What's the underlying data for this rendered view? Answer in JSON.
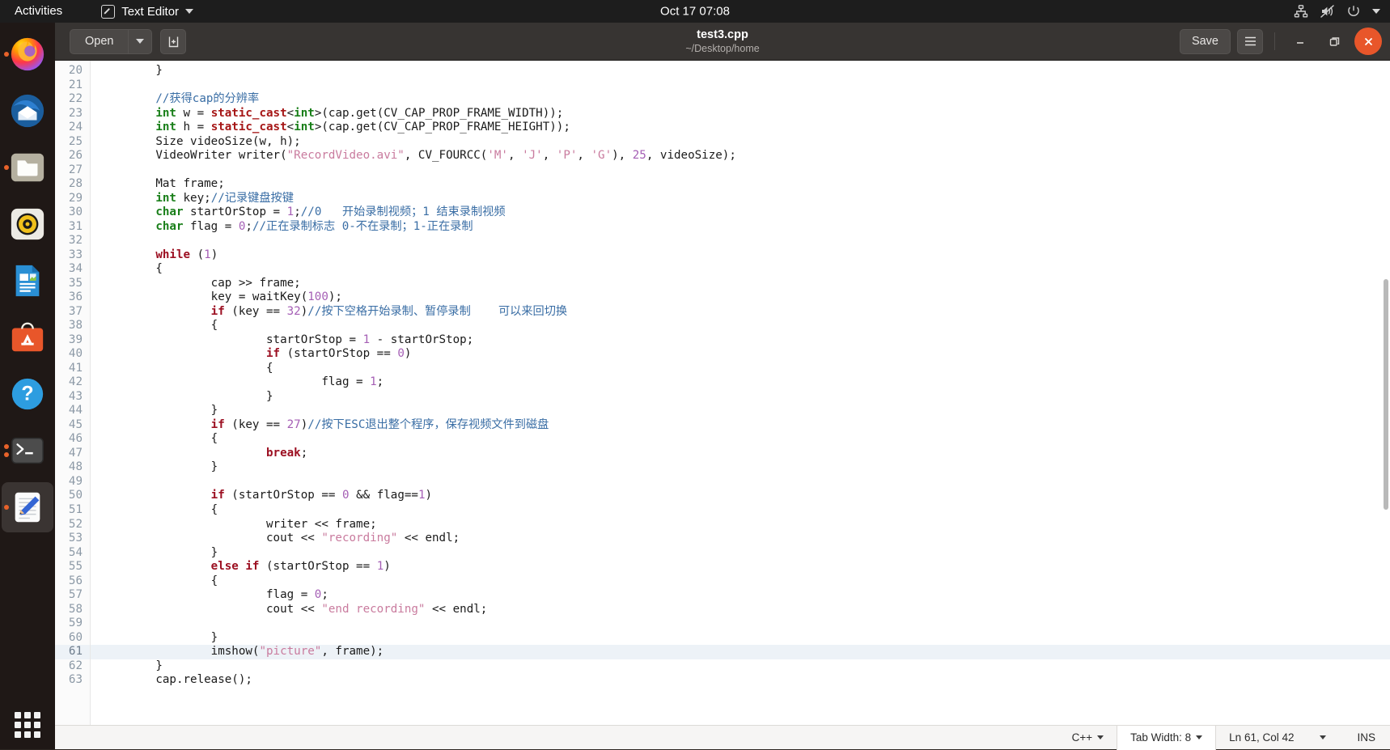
{
  "topbar": {
    "activities": "Activities",
    "app_name": "Text Editor",
    "clock": "Oct 17 07:08",
    "tray_icons": [
      "network-icon",
      "volume-muted-icon",
      "power-icon",
      "chevron-down-icon"
    ]
  },
  "dock": {
    "items": [
      {
        "name": "firefox",
        "label": "Firefox",
        "dots": 1,
        "active": false
      },
      {
        "name": "thunderbird",
        "label": "Thunderbird",
        "dots": 0,
        "active": false
      },
      {
        "name": "files",
        "label": "Files",
        "dots": 1,
        "active": false
      },
      {
        "name": "rhythmbox",
        "label": "Rhythmbox",
        "dots": 0,
        "active": false
      },
      {
        "name": "libreoffice-writer",
        "label": "LibreOffice Writer",
        "dots": 0,
        "active": false
      },
      {
        "name": "ubuntu-software",
        "label": "Ubuntu Software",
        "dots": 0,
        "active": false
      },
      {
        "name": "help",
        "label": "Help",
        "dots": 0,
        "active": false
      },
      {
        "name": "terminal",
        "label": "Terminal",
        "dots": 2,
        "active": false
      },
      {
        "name": "text-editor",
        "label": "Text Editor",
        "dots": 1,
        "active": true
      }
    ],
    "show_apps_label": "Show Applications"
  },
  "headerbar": {
    "open_label": "Open",
    "open_dropdown_icon": "chevron-down-icon",
    "new_document_icon": "new-document-icon",
    "title": "test3.cpp",
    "subtitle": "~/Desktop/home",
    "save_label": "Save",
    "menu_icon": "hamburger-menu-icon",
    "minimize_icon": "minimize-icon",
    "maximize_icon": "maximize-icon",
    "close_icon": "close-icon",
    "close_color": "#e8562a"
  },
  "statusbar": {
    "language": "C++",
    "tab_width": "Tab Width: 8",
    "position": "Ln 61, Col 42",
    "insert_mode": "INS",
    "caret_icon": "chevron-down-icon"
  },
  "editor": {
    "first_line": 20,
    "current_line": 61,
    "lines": [
      {
        "n": 20,
        "tokens": [
          {
            "c": "",
            "s": "        }"
          }
        ]
      },
      {
        "n": 21,
        "tokens": [
          {
            "c": "",
            "s": ""
          }
        ]
      },
      {
        "n": 22,
        "tokens": [
          {
            "c": "cm",
            "s": "        //获得cap的分辨率"
          }
        ]
      },
      {
        "n": 23,
        "tokens": [
          {
            "c": "",
            "s": "        "
          },
          {
            "c": "t",
            "s": "int"
          },
          {
            "c": "",
            "s": " w = "
          },
          {
            "c": "cst",
            "s": "static_cast"
          },
          {
            "c": "",
            "s": "<"
          },
          {
            "c": "t",
            "s": "int"
          },
          {
            "c": "",
            "s": ">(cap.get(CV_CAP_PROP_FRAME_WIDTH));"
          }
        ]
      },
      {
        "n": 24,
        "tokens": [
          {
            "c": "",
            "s": "        "
          },
          {
            "c": "t",
            "s": "int"
          },
          {
            "c": "",
            "s": " h = "
          },
          {
            "c": "cst",
            "s": "static_cast"
          },
          {
            "c": "",
            "s": "<"
          },
          {
            "c": "t",
            "s": "int"
          },
          {
            "c": "",
            "s": ">(cap.get(CV_CAP_PROP_FRAME_HEIGHT));"
          }
        ]
      },
      {
        "n": 25,
        "tokens": [
          {
            "c": "",
            "s": "        Size videoSize(w, h);"
          }
        ]
      },
      {
        "n": 26,
        "tokens": [
          {
            "c": "",
            "s": "        VideoWriter writer("
          },
          {
            "c": "st",
            "s": "\"RecordVideo.avi\""
          },
          {
            "c": "",
            "s": ", CV_FOURCC("
          },
          {
            "c": "st",
            "s": "'M'"
          },
          {
            "c": "",
            "s": ", "
          },
          {
            "c": "st",
            "s": "'J'"
          },
          {
            "c": "",
            "s": ", "
          },
          {
            "c": "st",
            "s": "'P'"
          },
          {
            "c": "",
            "s": ", "
          },
          {
            "c": "st",
            "s": "'G'"
          },
          {
            "c": "",
            "s": "), "
          },
          {
            "c": "nm",
            "s": "25"
          },
          {
            "c": "",
            "s": ", videoSize);"
          }
        ]
      },
      {
        "n": 27,
        "tokens": [
          {
            "c": "",
            "s": ""
          }
        ]
      },
      {
        "n": 28,
        "tokens": [
          {
            "c": "",
            "s": "        Mat frame;"
          }
        ]
      },
      {
        "n": 29,
        "tokens": [
          {
            "c": "",
            "s": "        "
          },
          {
            "c": "t",
            "s": "int"
          },
          {
            "c": "",
            "s": " key;"
          },
          {
            "c": "cm",
            "s": "//记录键盘按键"
          }
        ]
      },
      {
        "n": 30,
        "tokens": [
          {
            "c": "",
            "s": "        "
          },
          {
            "c": "t",
            "s": "char"
          },
          {
            "c": "",
            "s": " startOrStop = "
          },
          {
            "c": "nm",
            "s": "1"
          },
          {
            "c": "",
            "s": ";"
          },
          {
            "c": "cm",
            "s": "//0   开始录制视频；1 结束录制视频"
          }
        ]
      },
      {
        "n": 31,
        "tokens": [
          {
            "c": "",
            "s": "        "
          },
          {
            "c": "t",
            "s": "char"
          },
          {
            "c": "",
            "s": " flag = "
          },
          {
            "c": "nm",
            "s": "0"
          },
          {
            "c": "",
            "s": ";"
          },
          {
            "c": "cm",
            "s": "//正在录制标志 0-不在录制；1-正在录制"
          }
        ]
      },
      {
        "n": 32,
        "tokens": [
          {
            "c": "",
            "s": ""
          }
        ]
      },
      {
        "n": 33,
        "tokens": [
          {
            "c": "",
            "s": "        "
          },
          {
            "c": "k",
            "s": "while"
          },
          {
            "c": "",
            "s": " ("
          },
          {
            "c": "nm",
            "s": "1"
          },
          {
            "c": "",
            "s": ")"
          }
        ]
      },
      {
        "n": 34,
        "tokens": [
          {
            "c": "",
            "s": "        {"
          }
        ]
      },
      {
        "n": 35,
        "tokens": [
          {
            "c": "",
            "s": "                cap >> frame;"
          }
        ]
      },
      {
        "n": 36,
        "tokens": [
          {
            "c": "",
            "s": "                key = waitKey("
          },
          {
            "c": "nm",
            "s": "100"
          },
          {
            "c": "",
            "s": ");"
          }
        ]
      },
      {
        "n": 37,
        "tokens": [
          {
            "c": "",
            "s": "                "
          },
          {
            "c": "k",
            "s": "if"
          },
          {
            "c": "",
            "s": " (key == "
          },
          {
            "c": "nm",
            "s": "32"
          },
          {
            "c": "",
            "s": ")"
          },
          {
            "c": "cm",
            "s": "//按下空格开始录制、暂停录制    可以来回切换"
          }
        ]
      },
      {
        "n": 38,
        "tokens": [
          {
            "c": "",
            "s": "                {"
          }
        ]
      },
      {
        "n": 39,
        "tokens": [
          {
            "c": "",
            "s": "                        startOrStop = "
          },
          {
            "c": "nm",
            "s": "1"
          },
          {
            "c": "",
            "s": " - startOrStop;"
          }
        ]
      },
      {
        "n": 40,
        "tokens": [
          {
            "c": "",
            "s": "                        "
          },
          {
            "c": "k",
            "s": "if"
          },
          {
            "c": "",
            "s": " (startOrStop == "
          },
          {
            "c": "nm",
            "s": "0"
          },
          {
            "c": "",
            "s": ")"
          }
        ]
      },
      {
        "n": 41,
        "tokens": [
          {
            "c": "",
            "s": "                        {"
          }
        ]
      },
      {
        "n": 42,
        "tokens": [
          {
            "c": "",
            "s": "                                flag = "
          },
          {
            "c": "nm",
            "s": "1"
          },
          {
            "c": "",
            "s": ";"
          }
        ]
      },
      {
        "n": 43,
        "tokens": [
          {
            "c": "",
            "s": "                        }"
          }
        ]
      },
      {
        "n": 44,
        "tokens": [
          {
            "c": "",
            "s": "                }"
          }
        ]
      },
      {
        "n": 45,
        "tokens": [
          {
            "c": "",
            "s": "                "
          },
          {
            "c": "k",
            "s": "if"
          },
          {
            "c": "",
            "s": " (key == "
          },
          {
            "c": "nm",
            "s": "27"
          },
          {
            "c": "",
            "s": ")"
          },
          {
            "c": "cm",
            "s": "//按下ESC退出整个程序，保存视频文件到磁盘"
          }
        ]
      },
      {
        "n": 46,
        "tokens": [
          {
            "c": "",
            "s": "                {"
          }
        ]
      },
      {
        "n": 47,
        "tokens": [
          {
            "c": "",
            "s": "                        "
          },
          {
            "c": "k",
            "s": "break"
          },
          {
            "c": "",
            "s": ";"
          }
        ]
      },
      {
        "n": 48,
        "tokens": [
          {
            "c": "",
            "s": "                }"
          }
        ]
      },
      {
        "n": 49,
        "tokens": [
          {
            "c": "",
            "s": ""
          }
        ]
      },
      {
        "n": 50,
        "tokens": [
          {
            "c": "",
            "s": "                "
          },
          {
            "c": "k",
            "s": "if"
          },
          {
            "c": "",
            "s": " (startOrStop == "
          },
          {
            "c": "nm",
            "s": "0"
          },
          {
            "c": "",
            "s": " && flag=="
          },
          {
            "c": "nm",
            "s": "1"
          },
          {
            "c": "",
            "s": ")"
          }
        ]
      },
      {
        "n": 51,
        "tokens": [
          {
            "c": "",
            "s": "                {"
          }
        ]
      },
      {
        "n": 52,
        "tokens": [
          {
            "c": "",
            "s": "                        writer << frame;"
          }
        ]
      },
      {
        "n": 53,
        "tokens": [
          {
            "c": "",
            "s": "                        cout << "
          },
          {
            "c": "st",
            "s": "\"recording\""
          },
          {
            "c": "",
            "s": " << endl;"
          }
        ]
      },
      {
        "n": 54,
        "tokens": [
          {
            "c": "",
            "s": "                }"
          }
        ]
      },
      {
        "n": 55,
        "tokens": [
          {
            "c": "",
            "s": "                "
          },
          {
            "c": "k",
            "s": "else if"
          },
          {
            "c": "",
            "s": " (startOrStop == "
          },
          {
            "c": "nm",
            "s": "1"
          },
          {
            "c": "",
            "s": ")"
          }
        ]
      },
      {
        "n": 56,
        "tokens": [
          {
            "c": "",
            "s": "                {"
          }
        ]
      },
      {
        "n": 57,
        "tokens": [
          {
            "c": "",
            "s": "                        flag = "
          },
          {
            "c": "nm",
            "s": "0"
          },
          {
            "c": "",
            "s": ";"
          }
        ]
      },
      {
        "n": 58,
        "tokens": [
          {
            "c": "",
            "s": "                        cout << "
          },
          {
            "c": "st",
            "s": "\"end recording\""
          },
          {
            "c": "",
            "s": " << endl;"
          }
        ]
      },
      {
        "n": 59,
        "tokens": [
          {
            "c": "",
            "s": ""
          }
        ]
      },
      {
        "n": 60,
        "tokens": [
          {
            "c": "",
            "s": "                }"
          }
        ]
      },
      {
        "n": 61,
        "tokens": [
          {
            "c": "",
            "s": "                imshow("
          },
          {
            "c": "st",
            "s": "\"picture\""
          },
          {
            "c": "",
            "s": ", frame);"
          }
        ]
      },
      {
        "n": 62,
        "tokens": [
          {
            "c": "",
            "s": "        }"
          }
        ]
      },
      {
        "n": 63,
        "tokens": [
          {
            "c": "",
            "s": "        cap.release();"
          }
        ]
      }
    ]
  }
}
